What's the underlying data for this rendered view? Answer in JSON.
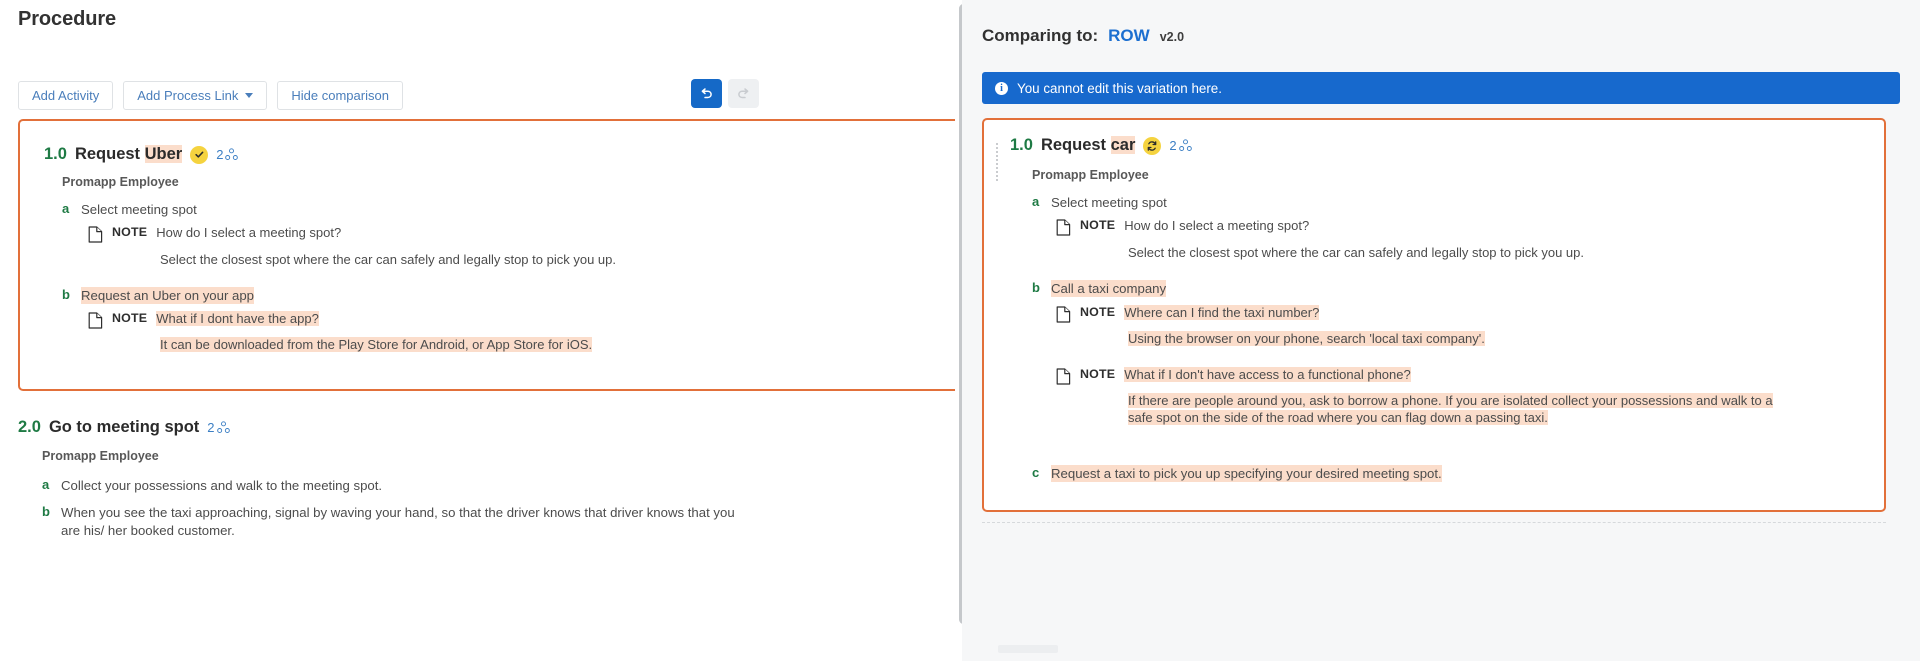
{
  "left": {
    "page_title": "Procedure",
    "toolbar": {
      "add_activity": "Add Activity",
      "add_process_link": "Add Process Link",
      "hide_comparison": "Hide comparison"
    },
    "history": {
      "undo_name": "undo",
      "redo_name": "redo"
    },
    "activities": [
      {
        "number": "1.0",
        "title_plain": "Request ",
        "title_highlight": "Uber",
        "status_icon": "check-badge",
        "link_count": "2",
        "role": "Promapp Employee",
        "tasks": [
          {
            "letter": "a",
            "text": "Select meeting spot",
            "highlighted": false,
            "notes": [
              {
                "label": "NOTE",
                "question": "How do I select a meeting spot?",
                "answer": "Select the closest spot where the car can safely and legally stop to pick you up.",
                "highlighted": false
              }
            ]
          },
          {
            "letter": "b",
            "text": "Request an Uber on your app",
            "highlighted": true,
            "notes": [
              {
                "label": "NOTE",
                "question": "What if I dont have the app?",
                "answer": "It can be downloaded from the Play Store for Android, or App Store for iOS.",
                "highlighted": true,
                "question_prefix": "Wh",
                "question_highlight": "at if I dont have the app?"
              }
            ]
          }
        ]
      },
      {
        "number": "2.0",
        "title_plain": "Go to meeting spot",
        "title_highlight": "",
        "status_icon": "",
        "link_count": "2",
        "role": "Promapp Employee",
        "tasks": [
          {
            "letter": "a",
            "text": "Collect your possessions and walk to the meeting spot.",
            "highlighted": false,
            "notes": []
          },
          {
            "letter": "b",
            "text": "When you see the taxi approaching, signal by waving your hand, so that the driver knows that driver knows that you are his/ her booked customer.",
            "highlighted": false,
            "notes": []
          }
        ]
      }
    ]
  },
  "right": {
    "compare_label": "Comparing to:",
    "compare_name": "ROW",
    "compare_version": "v2.0",
    "banner_text": "You cannot edit this variation here.",
    "banner_icon": "info-icon",
    "banner_color": "#1769cd",
    "activity": {
      "number": "1.0",
      "title_plain": "Request ",
      "title_highlight": "car",
      "status_icon": "sync-badge",
      "link_count": "2",
      "role": "Promapp Employee",
      "tasks": [
        {
          "letter": "a",
          "text": "Select meeting spot",
          "highlighted": false,
          "notes": [
            {
              "label": "NOTE",
              "question": "How do I select a meeting spot?",
              "answer": "Select the closest spot where the car can safely and legally stop to pick you up.",
              "highlighted": false
            }
          ]
        },
        {
          "letter": "b",
          "text": "Call a taxi company",
          "highlighted": true,
          "notes": [
            {
              "label": "NOTE",
              "question": "Where can I find the taxi number?",
              "answer": "Using the browser on your phone, search 'local taxi company'.",
              "highlighted": true
            },
            {
              "label": "NOTE",
              "question": "What if I don't have access to a functional phone?",
              "answer": "If there are people around you, ask to borrow a phone. If you are isolated collect your possessions and walk to a safe spot on the side of the road where you can flag down a passing taxi.",
              "highlighted": true
            }
          ]
        },
        {
          "letter": "c",
          "text": "Request a taxi to pick you up specifying your desired meeting spot.",
          "highlighted": true,
          "notes": []
        }
      ]
    }
  },
  "colors": {
    "card_border": "#e2703a",
    "highlight": "#fbddcb",
    "accent_blue": "#1c6fd0",
    "green": "#1e7a44",
    "badge_yellow": "#f5d33f"
  }
}
